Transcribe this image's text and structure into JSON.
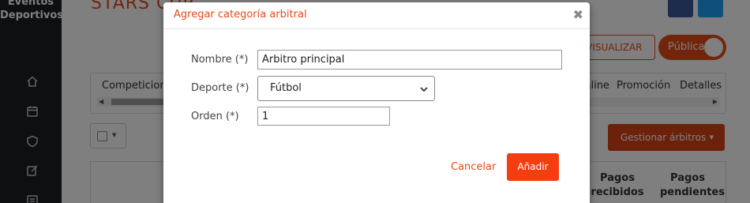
{
  "sidebar": {
    "brand": "Eventos Deportivos",
    "icons": [
      "home-icon",
      "calendar-icon",
      "shield-icon",
      "edit-icon",
      "list-icon"
    ]
  },
  "header": {
    "title": "STARS CUP",
    "preview_button": "PREVISUALIZAR",
    "public_toggle": "Pública"
  },
  "tabs": [
    "Competiciones",
    "Online",
    "Promoción",
    "Detalles"
  ],
  "toolbar": {
    "manage_button": "Gestionar árbitros"
  },
  "table": {
    "columns": [
      "Pagos recibidos",
      "Pagos pendientes"
    ]
  },
  "modal": {
    "title": "Agregar categoría arbitral",
    "close": "✖",
    "fields": {
      "name_label": "Nombre (*)",
      "name_value": "Árbitro principal",
      "sport_label": "Deporte (*)",
      "sport_value": "Fútbol",
      "order_label": "Orden (*)",
      "order_value": "1"
    },
    "cancel": "Cancelar",
    "add": "Añadir"
  },
  "colors": {
    "accent": "#e64a19",
    "primary_button": "#f43e10",
    "sidebar_bg": "#1d1f21"
  }
}
